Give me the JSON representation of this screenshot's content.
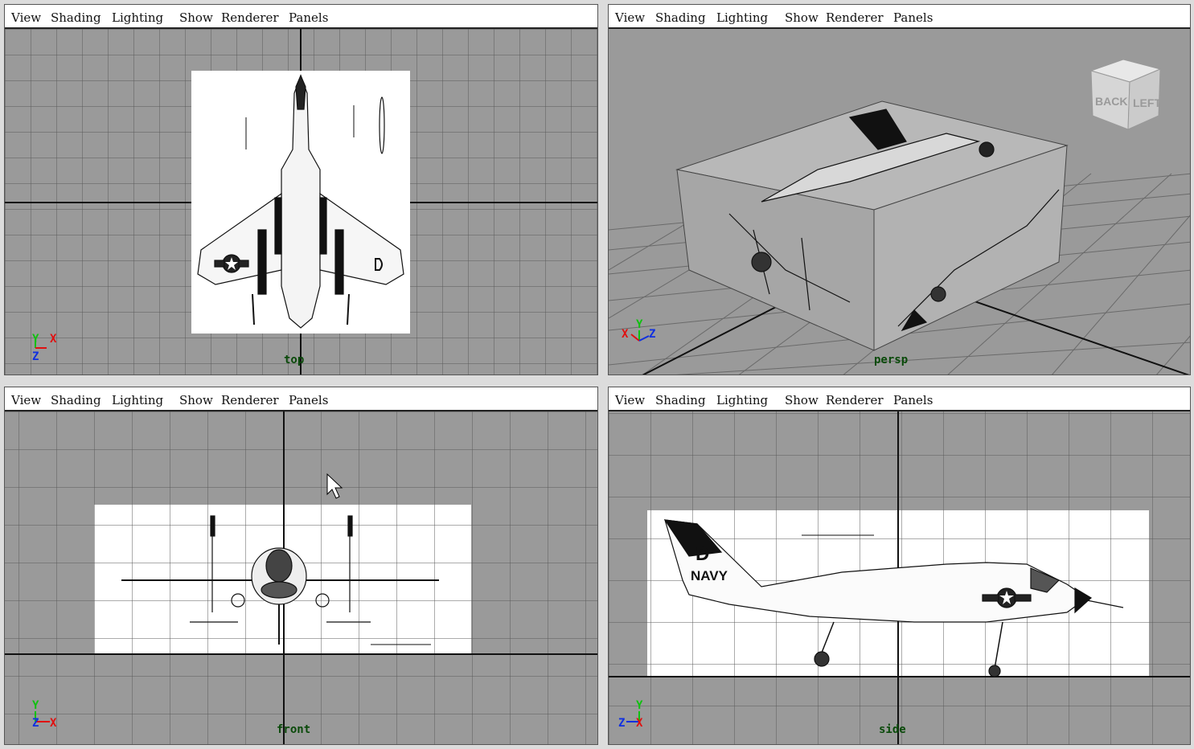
{
  "menu": [
    "View",
    "Shading",
    "Lighting",
    "Show",
    "Renderer",
    "Panels"
  ],
  "viewports": {
    "top": {
      "camera": "top"
    },
    "persp": {
      "camera": "persp"
    },
    "front": {
      "camera": "front"
    },
    "side": {
      "camera": "side"
    }
  },
  "view_cube": {
    "face_back": "BACK",
    "face_left": "LEFT"
  },
  "side_view": {
    "tail_letter": "D",
    "tail_text": "NAVY"
  },
  "axes": {
    "x": "X",
    "y": "Y",
    "z": "Z"
  },
  "colors": {
    "viewport_bg": "#9a9a9a",
    "grid": "#555555",
    "axis_x": "#e01010",
    "axis_y": "#10c010",
    "axis_z": "#1030e0",
    "label": "#0a4a0a"
  }
}
